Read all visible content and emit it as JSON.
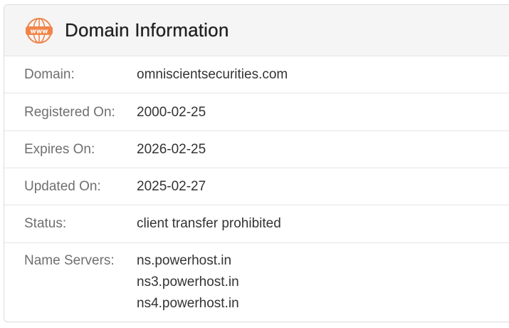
{
  "header": {
    "title": "Domain Information",
    "icon": "www-globe-icon",
    "accent_color": "#f0854a"
  },
  "rows": [
    {
      "label": "Domain:",
      "value": "omniscientsecurities.com"
    },
    {
      "label": "Registered On:",
      "value": "2000-02-25"
    },
    {
      "label": "Expires On:",
      "value": "2026-02-25"
    },
    {
      "label": "Updated On:",
      "value": "2025-02-27"
    },
    {
      "label": "Status:",
      "value": "client transfer prohibited"
    },
    {
      "label": "Name Servers:",
      "values": [
        "ns.powerhost.in",
        "ns3.powerhost.in",
        "ns4.powerhost.in"
      ]
    }
  ]
}
